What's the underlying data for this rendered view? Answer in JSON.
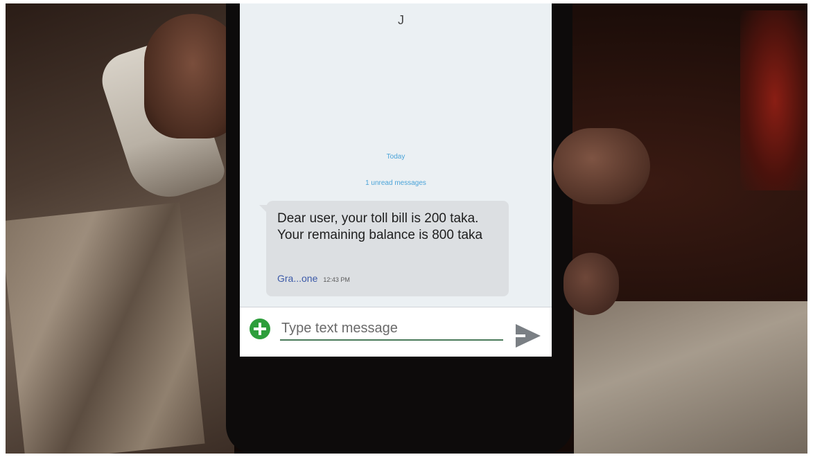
{
  "conversation": {
    "status_mark": "J",
    "date_label": "Today",
    "unread_label": "1 unread messages",
    "message": {
      "text": "Dear user, your toll bill is 200 taka. Your remaining balance is 800 taka",
      "sender": "Gra...one",
      "time": "12:43 PM"
    }
  },
  "composer": {
    "placeholder": "Type text message",
    "add_icon": "plus-circle-icon",
    "send_icon": "send-arrow-icon"
  },
  "colors": {
    "add_icon": "#2e9e3c",
    "sender_link": "#3c5aa8",
    "date_label": "#4aa3d8",
    "bubble": "#dcdfe2"
  }
}
